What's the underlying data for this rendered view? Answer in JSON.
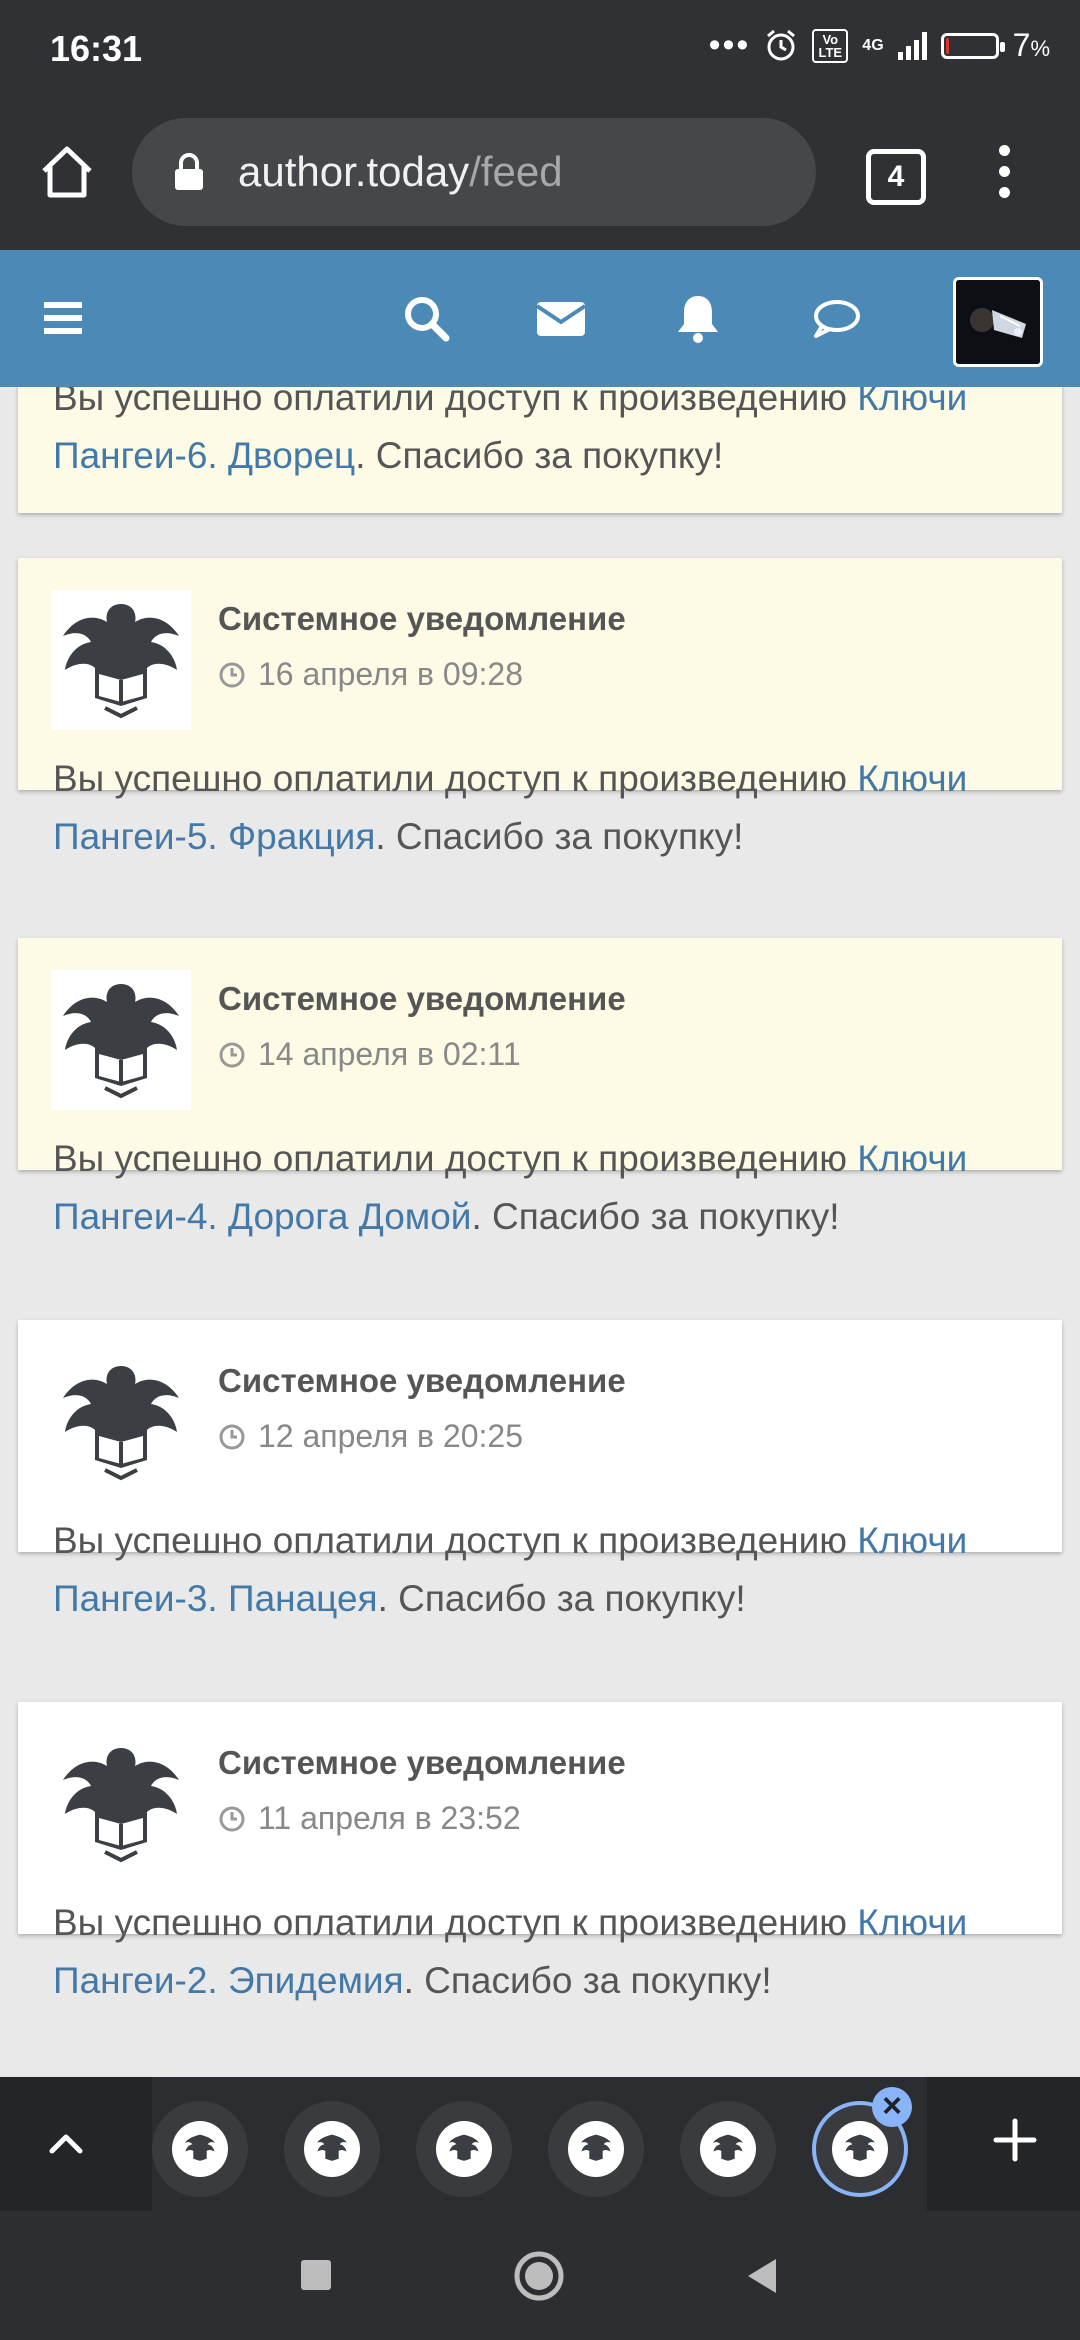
{
  "status_bar": {
    "time": "16:31",
    "network": "4G",
    "volte": "Vo LTE",
    "battery_percent": "7",
    "battery_unit": "%"
  },
  "browser": {
    "url_domain": "author.today",
    "url_path": "/feed",
    "tab_count": "4"
  },
  "header_icons": [
    "menu-icon",
    "search-icon",
    "mail-icon",
    "bell-icon",
    "chat-icon"
  ],
  "feed": {
    "top_fragment": {
      "prefix": "Вы успешно оплатили доступ к произведению ",
      "link": "Ключи Пангеи-6. Дворец",
      "suffix": ". Спасибо за покупку!"
    },
    "items": [
      {
        "title": "Системное уведомление",
        "date": "16 апреля в 09:28",
        "prefix": "Вы успешно оплатили доступ к произведению ",
        "link": "Ключи Пангеи-5. Фракция",
        "suffix": ". Спасибо за покупку!",
        "unread": true
      },
      {
        "title": "Системное уведомление",
        "date": "14 апреля в 02:11",
        "prefix": "Вы успешно оплатили доступ к произведению ",
        "link": "Ключи Пангеи-4. Дорога Домой",
        "suffix": ". Спасибо за покупку!",
        "unread": true
      },
      {
        "title": "Системное уведомление",
        "date": "12 апреля в 20:25",
        "prefix": "Вы успешно оплатили доступ к произведению ",
        "link": "Ключи Пангеи-3. Панацея",
        "suffix": ". Спасибо за покупку!",
        "unread": false
      },
      {
        "title": "Системное уведомление",
        "date": "11 апреля в 23:52",
        "prefix": "Вы успешно оплатили доступ к произведению ",
        "link": "Ключи Пангеи-2. Эпидемия",
        "suffix": ". Спасибо за покупку!",
        "unread": false
      }
    ]
  },
  "colors": {
    "site_header": "#4b89b6",
    "link": "#4279a8",
    "unread_bg": "#fdfbe6",
    "read_bg": "#ffffff",
    "tab_active_ring": "#8ab4f8"
  }
}
